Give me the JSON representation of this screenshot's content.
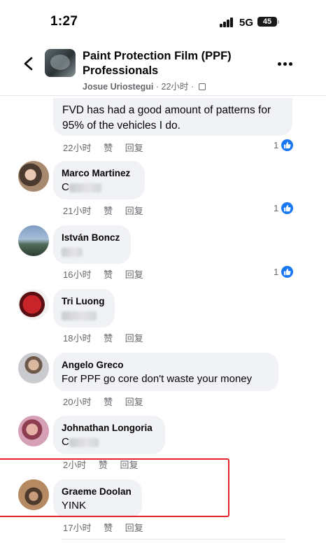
{
  "status_bar": {
    "time": "1:27",
    "network": "5G",
    "battery": "45"
  },
  "header": {
    "title": "Paint Protection Film (PPF) Professionals",
    "author": "Josue Uriostegui",
    "time": "22小时"
  },
  "comments": [
    {
      "text": "FVD has had a good amount of patterns for 95% of the vehicles I do.",
      "time": "22小时",
      "like_label": "赞",
      "reply_label": "回复",
      "likes": "1"
    },
    {
      "author": "Marco Martinez",
      "text": "C",
      "time": "21小时",
      "like_label": "赞",
      "reply_label": "回复",
      "likes": "1"
    },
    {
      "author": "István Boncz",
      "text": "",
      "time": "16小时",
      "like_label": "赞",
      "reply_label": "回复",
      "likes": "1"
    },
    {
      "author": "Tri Luong",
      "text": "",
      "time": "18小时",
      "like_label": "赞",
      "reply_label": "回复"
    },
    {
      "author": "Angelo Greco",
      "text": "For PPF go core don't waste your money",
      "time": "20小时",
      "like_label": "赞",
      "reply_label": "回复"
    },
    {
      "author": "Johnathan Longoria",
      "text": "C",
      "time": "2小时",
      "like_label": "赞",
      "reply_label": "回复"
    },
    {
      "author": "Graeme Doolan",
      "text": "YINK",
      "time": "17小时",
      "like_label": "赞",
      "reply_label": "回复"
    }
  ],
  "colors": {
    "like_blue": "#1877f2",
    "bubble_bg": "#f0f2f5",
    "highlight_red": "#e0262c",
    "meta_gray": "#65676b"
  },
  "icons": [
    "back-chevron-icon",
    "more-icon",
    "like-thumb-icon",
    "audience-icon",
    "signal-icon",
    "battery-icon"
  ]
}
